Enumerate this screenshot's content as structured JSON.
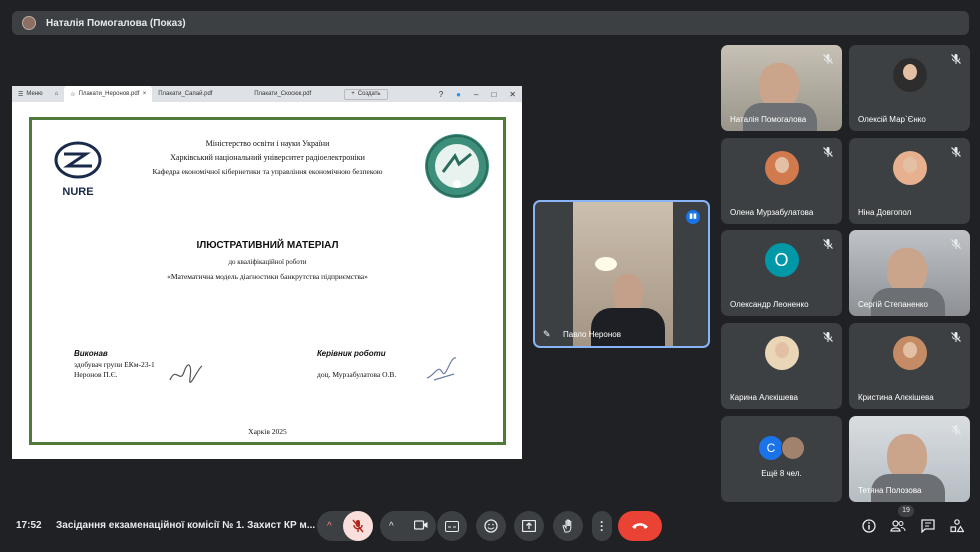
{
  "top_bar": {
    "title": "Наталія Помогалова (Показ)"
  },
  "pdf_viewer": {
    "menu_label": "Меню",
    "tabs": [
      "Плакати_Неронов.pdf",
      "Плакати_Сапай.pdf",
      "Плакати_Скосюк.pdf"
    ],
    "new_tab_label": "Создать"
  },
  "poster": {
    "ministry": "Міністерство освіти і науки України",
    "university": "Харківський національний університет радіоелектроніки",
    "department": "Кафедра економічної кібернетики та управління економічною безпекою",
    "logo_text": "NURE",
    "heading": "ІЛЮСТРАТИВНИЙ МАТЕРІАЛ",
    "subheading": "до кваліфікаційної роботи",
    "topic": "«Математична модель діагностики банкрутства підприємства»",
    "performed_label": "Виконав",
    "student_line1": "здобувач групи ЕКм-23-1",
    "student_line2": "Неронов П.Є.",
    "supervisor_label": "Керівник роботи",
    "supervisor_name": "доц. Мурзабулатова О.В.",
    "city_year": "Харків 2025"
  },
  "speaker": {
    "name": "Павло Неронов"
  },
  "participants": [
    {
      "name": "Наталія Помогалова",
      "avatar": "video"
    },
    {
      "name": "Олексій Мар`Єнко",
      "avatar": "photo"
    },
    {
      "name": "Олена Мурзабулатова",
      "avatar": "photo"
    },
    {
      "name": "Ніна Довгопол",
      "avatar": "photo"
    },
    {
      "name": "Олександр Леоненко",
      "avatar": "letter",
      "letter": "О",
      "color": "#0097a7"
    },
    {
      "name": "Сергій Степаненко",
      "avatar": "video"
    },
    {
      "name": "Карина Алєкішева",
      "avatar": "photo"
    },
    {
      "name": "Кристина Алєкішева",
      "avatar": "photo"
    },
    {
      "name": "Ещё 8 чел.",
      "avatar": "group",
      "letter": "С"
    },
    {
      "name": "Тетяна Полозова",
      "avatar": "video"
    }
  ],
  "bottom_bar": {
    "time": "17:52",
    "meeting_title": "Засідання екзаменаційної комісії № 1. Захист КР м...",
    "participants_count": "19"
  },
  "colors": {
    "accent": "#8ab4f8",
    "end_call": "#ea4335",
    "mic_off_bg": "#f9dedc"
  }
}
